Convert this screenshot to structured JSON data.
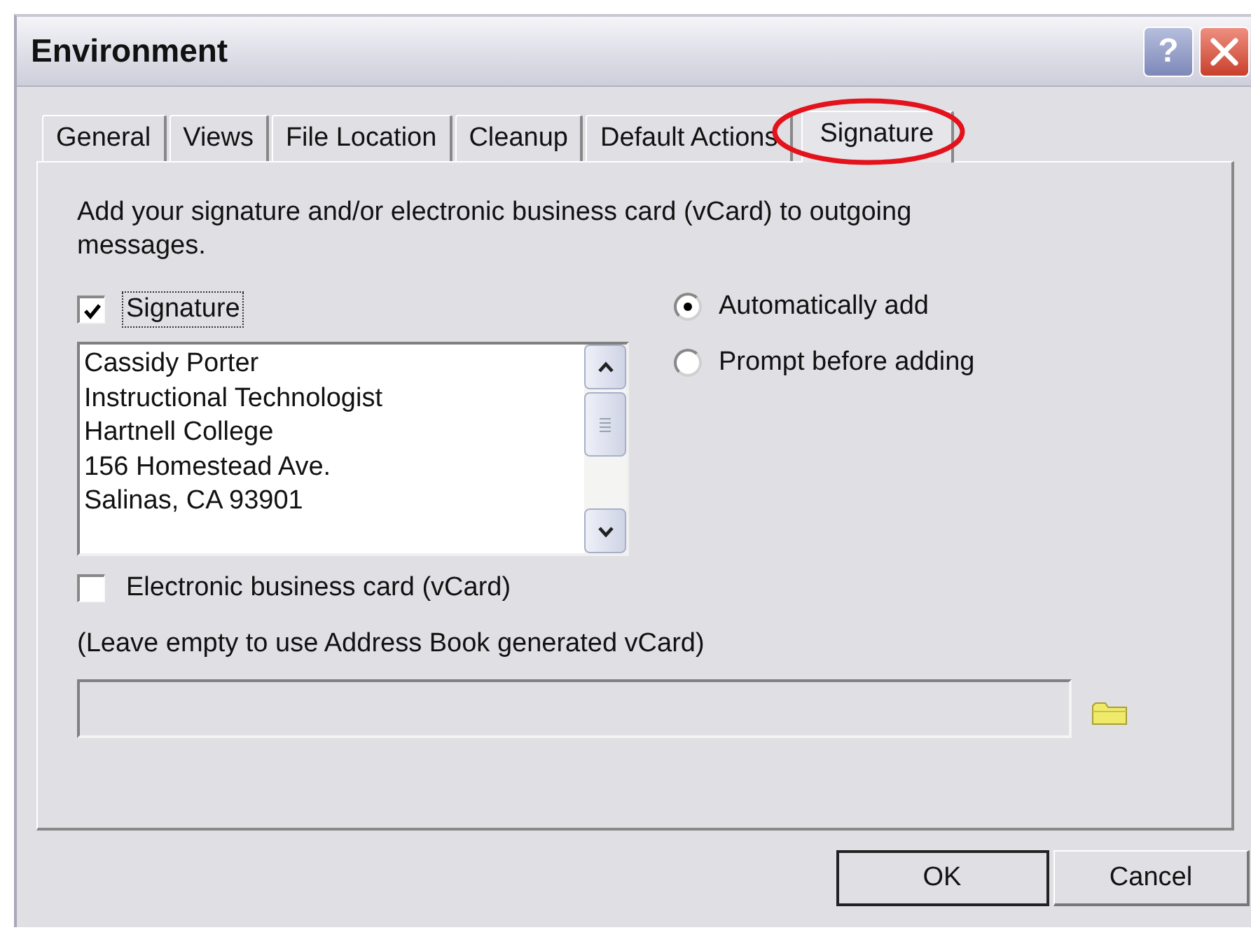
{
  "window": {
    "title": "Environment",
    "help_button": "?"
  },
  "tabs": [
    {
      "label": "General",
      "selected": false,
      "circled": false
    },
    {
      "label": "Views",
      "selected": false,
      "circled": false
    },
    {
      "label": "File Location",
      "selected": false,
      "circled": false
    },
    {
      "label": "Cleanup",
      "selected": false,
      "circled": false
    },
    {
      "label": "Default Actions",
      "selected": false,
      "circled": false
    },
    {
      "label": "Signature",
      "selected": true,
      "circled": true
    }
  ],
  "description": "Add your signature and/or electronic business card (vCard) to outgoing messages.",
  "signature": {
    "label": "Signature",
    "checked": true,
    "focused": true,
    "value": "Cassidy Porter\nInstructional Technologist\nHartnell College\n156 Homestead Ave.\nSalinas, CA 93901"
  },
  "add_mode": [
    {
      "label": "Automatically add",
      "selected": true
    },
    {
      "label": "Prompt before adding",
      "selected": false
    }
  ],
  "vcard": {
    "label": "Electronic business card (vCard)",
    "checked": false,
    "hint": "(Leave empty to use Address Book generated vCard)",
    "disabled": true
  },
  "buttons": [
    {
      "label": "OK",
      "default": true
    },
    {
      "label": "Cancel",
      "default": false
    }
  ]
}
